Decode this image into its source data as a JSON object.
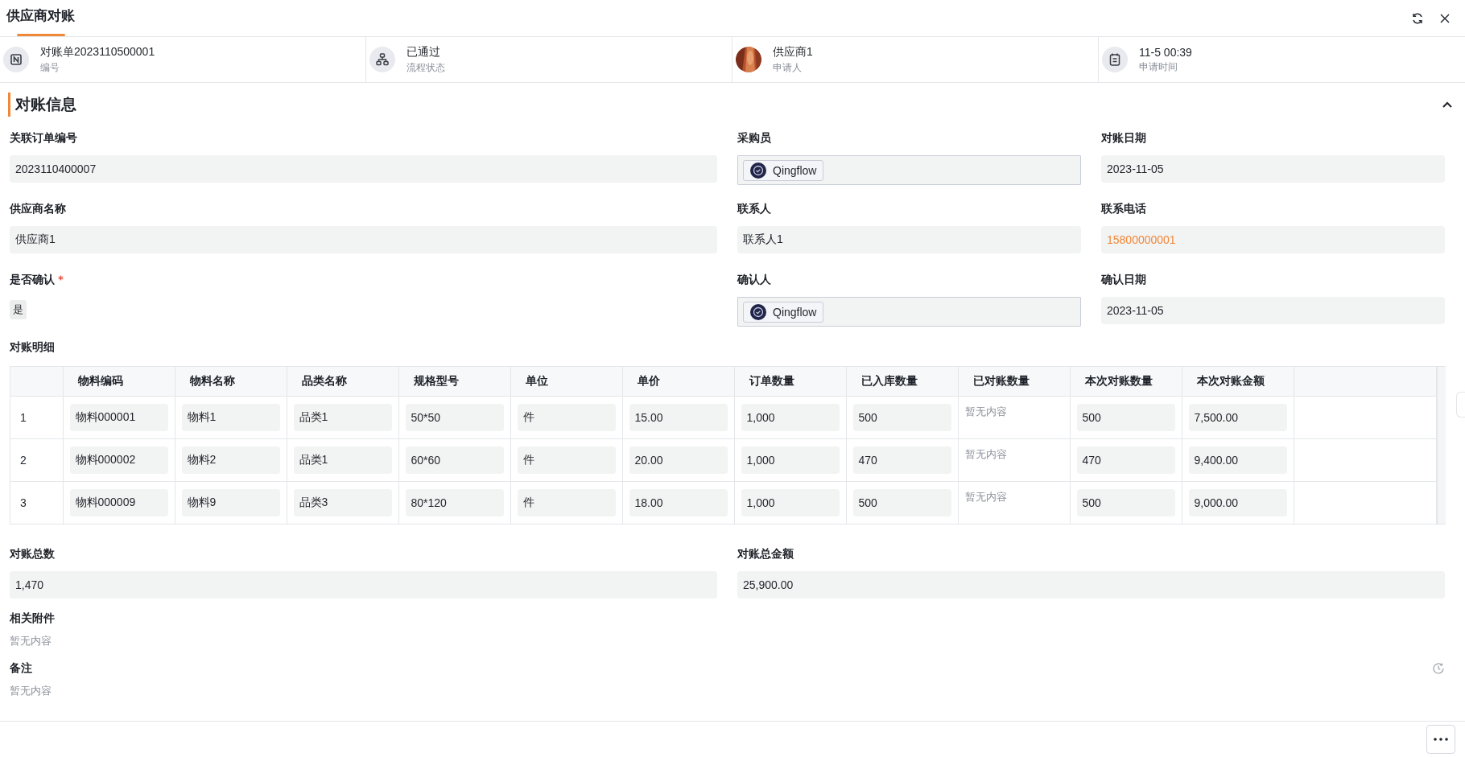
{
  "tabs": [
    {
      "label": "供应商对账",
      "selected": true
    }
  ],
  "summary": [
    {
      "kind": "number",
      "value": "对账单2023110500001",
      "caption": "编号"
    },
    {
      "kind": "flow",
      "value": "已通过",
      "caption": "流程状态"
    },
    {
      "value": "供应商1",
      "caption": "申请人"
    },
    {
      "kind": "date",
      "value": "11-5 00:39",
      "caption": "申请时间"
    }
  ],
  "section": {
    "title": "对账信息",
    "expanded": true
  },
  "rows": [
    {
      "fields": [
        {
          "label": "关联订单编号",
          "kind": "text",
          "value": "2023110400007",
          "required": false
        },
        {
          "label": "采购员",
          "kind": "user",
          "value": "Qingflow",
          "required": false
        },
        {
          "label": "对账日期",
          "kind": "text",
          "value": "2023-11-05",
          "required": false
        }
      ]
    },
    {
      "fields": [
        {
          "label": "供应商名称",
          "kind": "text",
          "value": "供应商1",
          "required": false
        },
        {
          "label": "联系人",
          "kind": "text",
          "value": "联系人1",
          "required": false
        },
        {
          "label": "联系电话",
          "kind": "phone",
          "value": "15800000001",
          "required": false
        }
      ]
    },
    {
      "fields": [
        {
          "label": "是否确认",
          "kind": "tag",
          "value": "是",
          "required": true
        },
        {
          "label": "确认人",
          "kind": "user",
          "value": "Qingflow",
          "required": false
        },
        {
          "label": "确认日期",
          "kind": "text",
          "value": "2023-11-05",
          "required": false
        }
      ]
    }
  ],
  "details": {
    "label": "对账明细",
    "columns": [
      "物料编码",
      "物料名称",
      "品类名称",
      "规格型号",
      "单位",
      "单价",
      "订单数量",
      "已入库数量",
      "已对账数量",
      "本次对账数量",
      "本次对账金额"
    ],
    "rows": [
      {
        "index": "1",
        "cells": [
          {
            "kind": "field",
            "value": "物料000001"
          },
          {
            "kind": "field",
            "value": "物料1"
          },
          {
            "kind": "field",
            "value": "品类1"
          },
          {
            "kind": "field",
            "value": "50*50"
          },
          {
            "kind": "field",
            "value": "件"
          },
          {
            "kind": "field",
            "value": "15.00"
          },
          {
            "kind": "field",
            "value": "1,000"
          },
          {
            "kind": "field",
            "value": "500"
          },
          {
            "kind": "empty",
            "value": "暂无内容"
          },
          {
            "kind": "field",
            "value": "500"
          },
          {
            "kind": "field",
            "value": "7,500.00"
          }
        ]
      },
      {
        "index": "2",
        "cells": [
          {
            "kind": "field",
            "value": "物料000002"
          },
          {
            "kind": "field",
            "value": "物料2"
          },
          {
            "kind": "field",
            "value": "品类1"
          },
          {
            "kind": "field",
            "value": "60*60"
          },
          {
            "kind": "field",
            "value": "件"
          },
          {
            "kind": "field",
            "value": "20.00"
          },
          {
            "kind": "field",
            "value": "1,000"
          },
          {
            "kind": "field",
            "value": "470"
          },
          {
            "kind": "empty",
            "value": "暂无内容"
          },
          {
            "kind": "field",
            "value": "470"
          },
          {
            "kind": "field",
            "value": "9,400.00"
          }
        ]
      },
      {
        "index": "3",
        "cells": [
          {
            "kind": "field",
            "value": "物料000009"
          },
          {
            "kind": "field",
            "value": "物料9"
          },
          {
            "kind": "field",
            "value": "品类3"
          },
          {
            "kind": "field",
            "value": "80*120"
          },
          {
            "kind": "field",
            "value": "件"
          },
          {
            "kind": "field",
            "value": "18.00"
          },
          {
            "kind": "field",
            "value": "1,000"
          },
          {
            "kind": "field",
            "value": "500"
          },
          {
            "kind": "empty",
            "value": "暂无内容"
          },
          {
            "kind": "field",
            "value": "500"
          },
          {
            "kind": "field",
            "value": "9,000.00"
          }
        ]
      }
    ]
  },
  "totals": [
    {
      "label": "对账总数",
      "value": "1,470"
    },
    {
      "label": "对账总金额",
      "value": "25,900.00"
    }
  ],
  "attachments": {
    "label": "相关附件",
    "empty_text": "暂无内容"
  },
  "remark": {
    "label": "备注",
    "empty_text": "暂无内容"
  }
}
